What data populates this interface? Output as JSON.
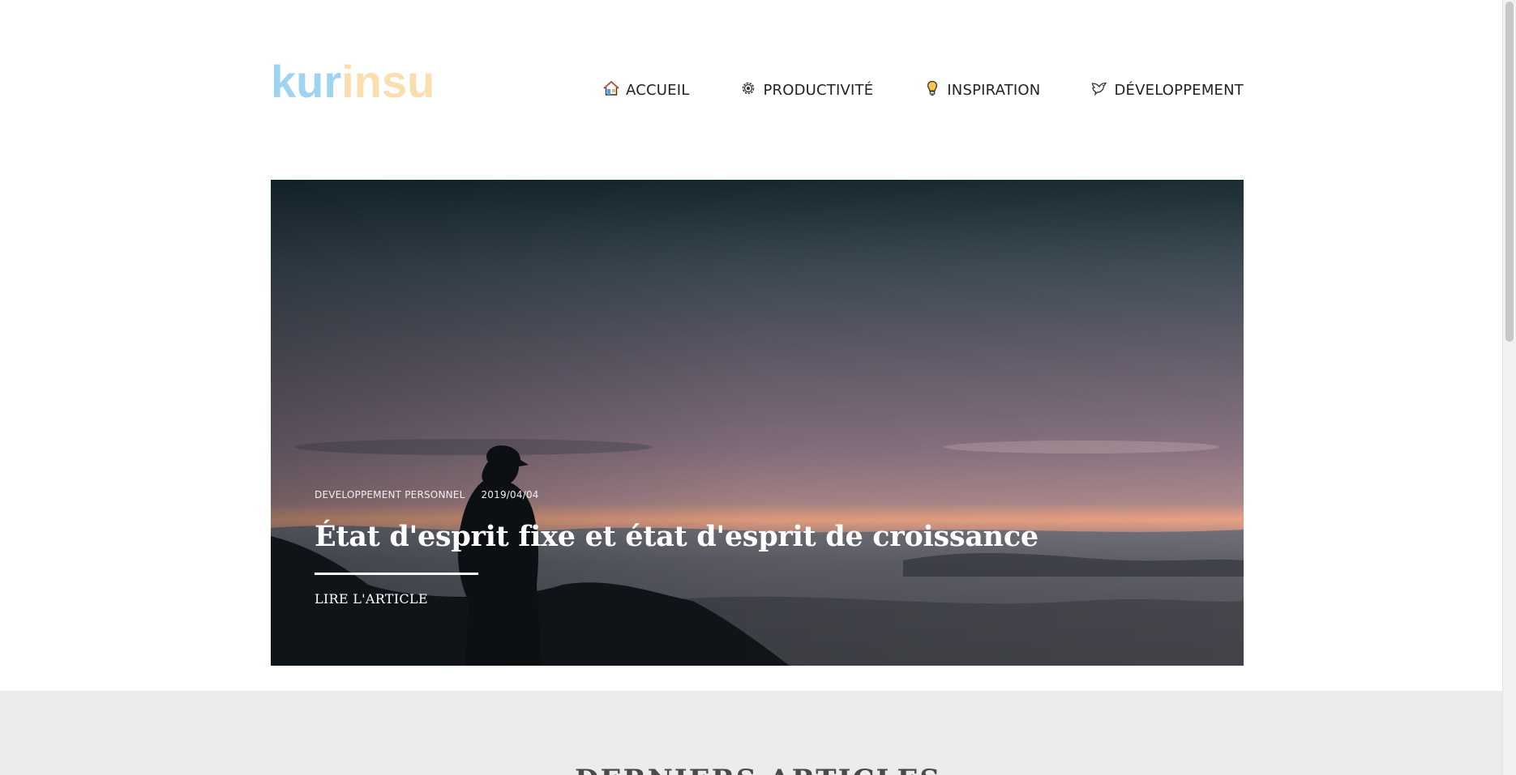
{
  "header": {
    "logo": {
      "part1": "kur",
      "part2": "insu"
    },
    "nav": [
      {
        "label": "ACCUEIL",
        "icon": "house-icon"
      },
      {
        "label": "PRODUCTIVITÉ",
        "icon": "gear-icon"
      },
      {
        "label": "INSPIRATION",
        "icon": "lightbulb-icon"
      },
      {
        "label": "DÉVELOPPEMENT",
        "icon": "dove-icon"
      }
    ]
  },
  "hero": {
    "category": "DEVELOPPEMENT PERSONNEL",
    "date": "2019/04/04",
    "title": "État d'esprit fixe et état d'esprit de croissance",
    "cta": "LIRE L'ARTICLE"
  },
  "latest": {
    "title": "DERNIERS ARTICLES"
  },
  "colors": {
    "logo_blue": "#9fd4f1",
    "logo_peach": "#fbdeb0",
    "band_gray": "#ececec"
  }
}
